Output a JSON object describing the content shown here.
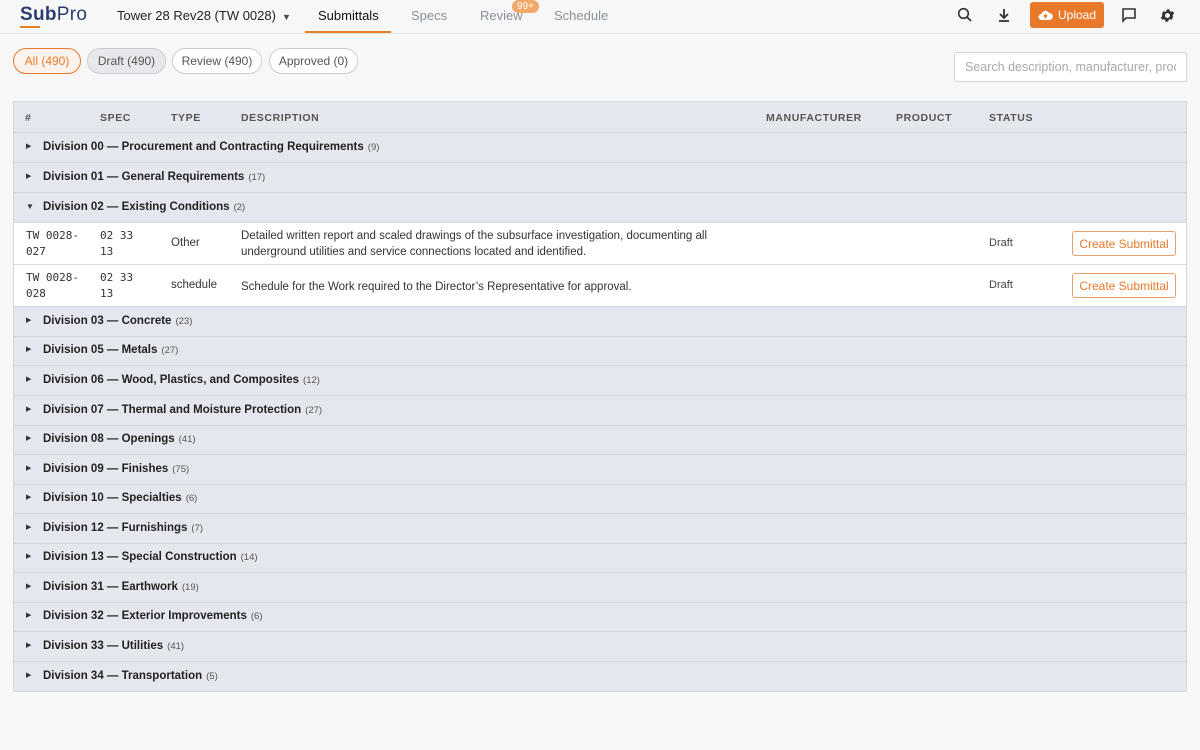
{
  "app": {
    "logo": "SubPro",
    "project": "Tower 28 Rev28 (TW 0028)",
    "nav": {
      "submittals": "Submittals",
      "specs": "Specs",
      "review": "Review",
      "review_badge": "99+",
      "schedule": "Schedule"
    },
    "upload_label": "Upload",
    "accent_color": "#e8792a"
  },
  "filters": {
    "all": "All (490)",
    "draft": "Draft (490)",
    "review": "Review (490)",
    "approved": "Approved (0)"
  },
  "search": {
    "placeholder": "Search description, manufacturer, product"
  },
  "table": {
    "headers": {
      "num": "#",
      "spec": "SPEC",
      "type": "TYPE",
      "description": "DESCRIPTION",
      "manufacturer": "MANUFACTURER",
      "product": "PRODUCT",
      "status": "STATUS"
    },
    "divisions": [
      {
        "name": "Division 00 — Procurement and Contracting Requirements",
        "count": "(9)",
        "expanded": false
      },
      {
        "name": "Division 01 — General Requirements",
        "count": "(17)",
        "expanded": false
      },
      {
        "name": "Division 02 — Existing Conditions",
        "count": "(2)",
        "expanded": true
      },
      {
        "name": "Division 03 — Concrete",
        "count": "(23)",
        "expanded": false
      },
      {
        "name": "Division 05 — Metals",
        "count": "(27)",
        "expanded": false
      },
      {
        "name": "Division 06 — Wood, Plastics, and Composites",
        "count": "(12)",
        "expanded": false
      },
      {
        "name": "Division 07 — Thermal and Moisture Protection",
        "count": "(27)",
        "expanded": false
      },
      {
        "name": "Division 08 — Openings",
        "count": "(41)",
        "expanded": false
      },
      {
        "name": "Division 09 — Finishes",
        "count": "(75)",
        "expanded": false
      },
      {
        "name": "Division 10 — Specialties",
        "count": "(6)",
        "expanded": false
      },
      {
        "name": "Division 12 — Furnishings",
        "count": "(7)",
        "expanded": false
      },
      {
        "name": "Division 13 — Special Construction",
        "count": "(14)",
        "expanded": false
      },
      {
        "name": "Division 31 — Earthwork",
        "count": "(19)",
        "expanded": false
      },
      {
        "name": "Division 32 — Exterior Improvements",
        "count": "(6)",
        "expanded": false
      },
      {
        "name": "Division 33 — Utilities",
        "count": "(41)",
        "expanded": false
      },
      {
        "name": "Division 34 — Transportation",
        "count": "(5)",
        "expanded": false
      }
    ],
    "items": [
      {
        "num_line1": "TW 0028-",
        "num_line2": "027",
        "spec_line1": "02 33",
        "spec_line2": "13",
        "type": "Other",
        "description": "Detailed written report and scaled drawings of the subsurface investigation, documenting all underground utilities and service connections located and identified.",
        "status": "Draft",
        "action": "Create Submittal"
      },
      {
        "num_line1": "TW 0028-",
        "num_line2": "028",
        "spec_line1": "02 33",
        "spec_line2": "13",
        "type": "schedule",
        "description": "Schedule for the Work required to the Director’s Representative for approval.",
        "status": "Draft",
        "action": "Create Submittal"
      }
    ]
  }
}
